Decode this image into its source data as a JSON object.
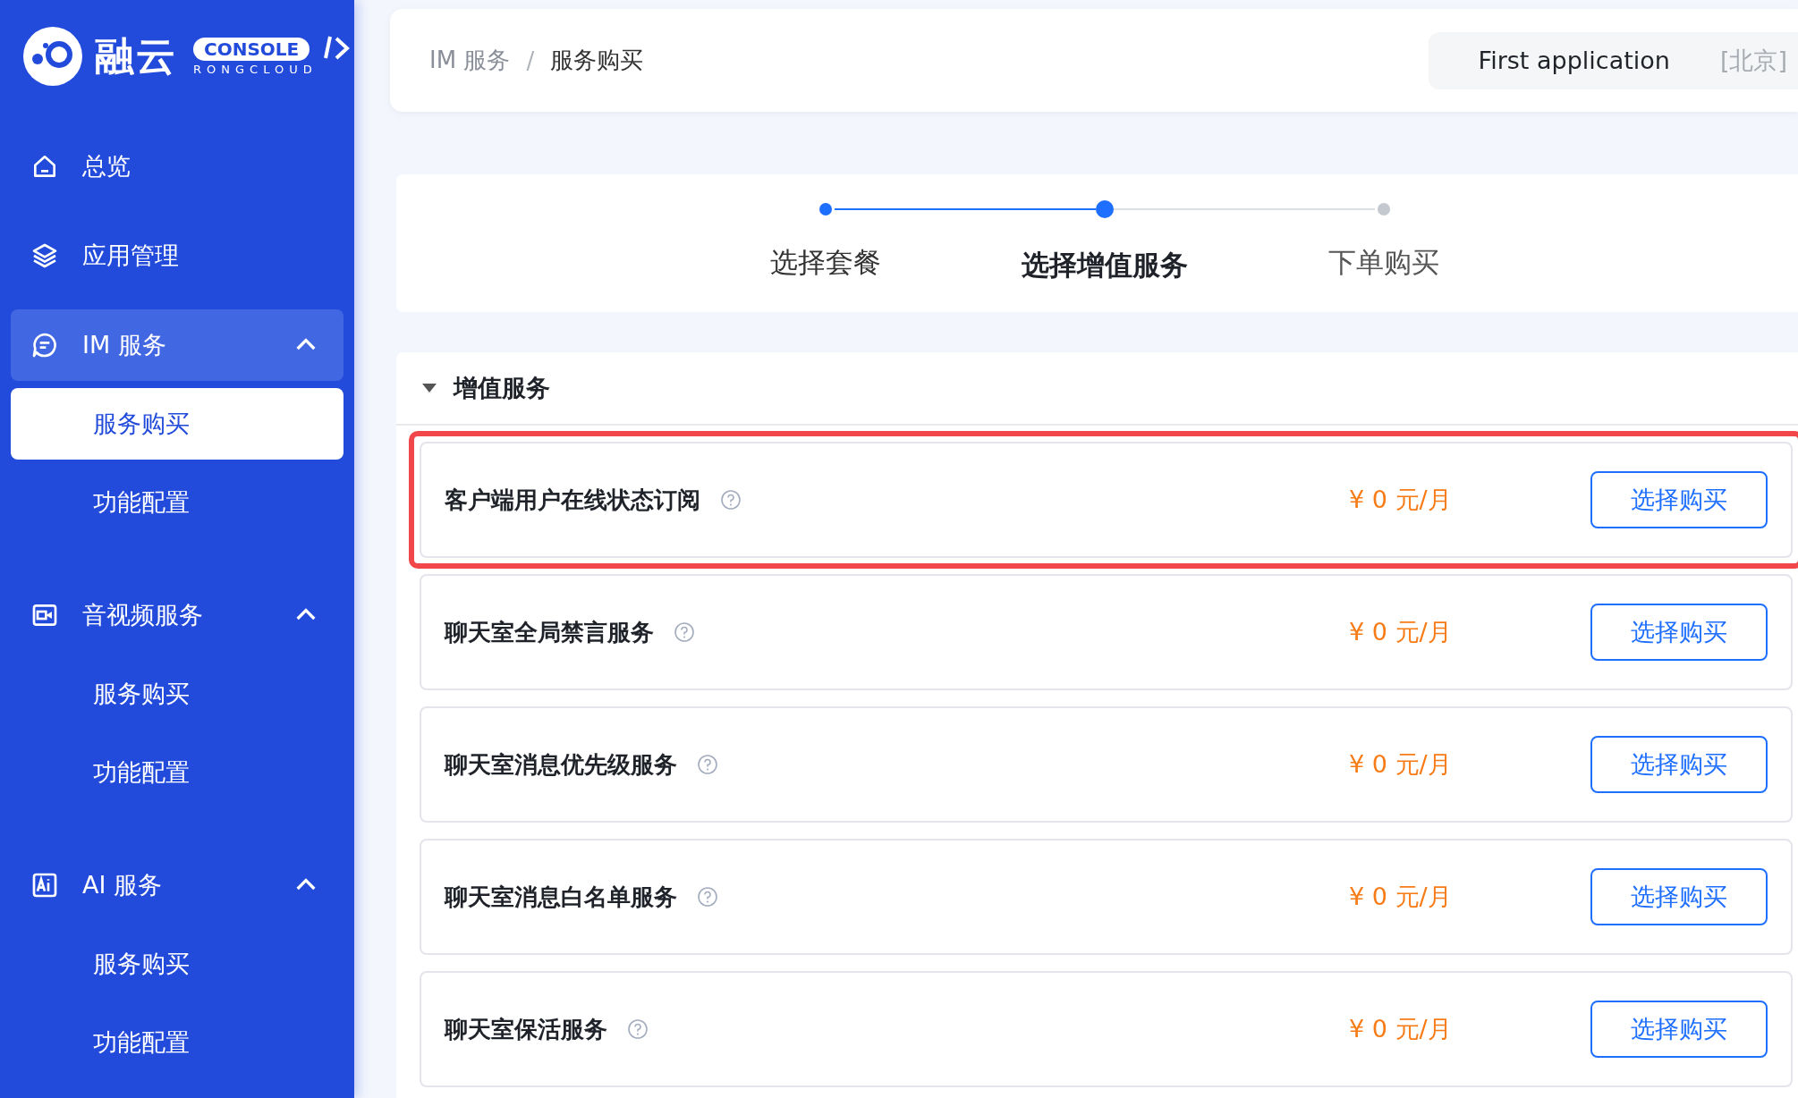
{
  "sidebar": {
    "logo": {
      "brand": "融云",
      "badge": "CONSOLE",
      "subtitle": "RONGCLOUD"
    },
    "items": [
      {
        "kind": "link",
        "label": "总览",
        "selected": false
      },
      {
        "kind": "link",
        "label": "应用管理",
        "selected": false
      },
      {
        "kind": "group",
        "label": "IM 服务",
        "selected": true,
        "expanded": true,
        "children": [
          {
            "label": "服务购买",
            "selected": true
          },
          {
            "label": "功能配置",
            "selected": false
          }
        ]
      },
      {
        "kind": "group",
        "label": "音视频服务",
        "selected": false,
        "expanded": true,
        "children": [
          {
            "label": "服务购买",
            "selected": false
          },
          {
            "label": "功能配置",
            "selected": false
          }
        ]
      },
      {
        "kind": "group",
        "label": "AI 服务",
        "selected": false,
        "expanded": true,
        "children": [
          {
            "label": "服务购买",
            "selected": false
          },
          {
            "label": "功能配置",
            "selected": false
          }
        ]
      }
    ]
  },
  "header": {
    "breadcrumb": [
      "IM 服务",
      "服务购买"
    ],
    "separator": "/",
    "app": {
      "name": "First application",
      "region": "[北京]"
    }
  },
  "steps": [
    {
      "label": "选择套餐",
      "done": true,
      "current": false
    },
    {
      "label": "选择增值服务",
      "done": false,
      "current": true
    },
    {
      "label": "下单购买",
      "done": false,
      "current": false
    }
  ],
  "section": {
    "title": "增值服务",
    "expanded": true,
    "services": [
      {
        "name": "客户端用户在线状态订阅",
        "price": "¥ 0 元/月",
        "button": "选择购买",
        "highlighted": true
      },
      {
        "name": "聊天室全局禁言服务",
        "price": "¥ 0 元/月",
        "button": "选择购买",
        "highlighted": false
      },
      {
        "name": "聊天室消息优先级服务",
        "price": "¥ 0 元/月",
        "button": "选择购买",
        "highlighted": false
      },
      {
        "name": "聊天室消息白名单服务",
        "price": "¥ 0 元/月",
        "button": "选择购买",
        "highlighted": false
      },
      {
        "name": "聊天室保活服务",
        "price": "¥ 0 元/月",
        "button": "选择购买",
        "highlighted": false
      }
    ]
  }
}
